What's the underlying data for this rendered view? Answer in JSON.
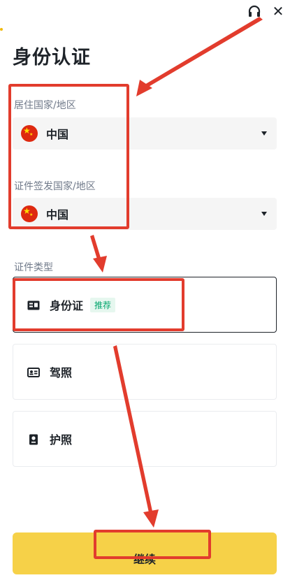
{
  "header": {
    "title": "身份认证"
  },
  "residence": {
    "label": "居住国家/地区",
    "value": "中国"
  },
  "issuing": {
    "label": "证件签发国家/地区",
    "value": "中国"
  },
  "id_type": {
    "label": "证件类型",
    "options": [
      {
        "label": "身份证",
        "badge": "推荐",
        "icon": "id-card-icon"
      },
      {
        "label": "驾照",
        "icon": "driver-license-icon"
      },
      {
        "label": "护照",
        "icon": "passport-icon"
      }
    ]
  },
  "footer": {
    "continue_label": "继续"
  },
  "colors": {
    "accent": "#f6d148",
    "annotation": "#e23c2d",
    "recommend": "#03a66d"
  }
}
